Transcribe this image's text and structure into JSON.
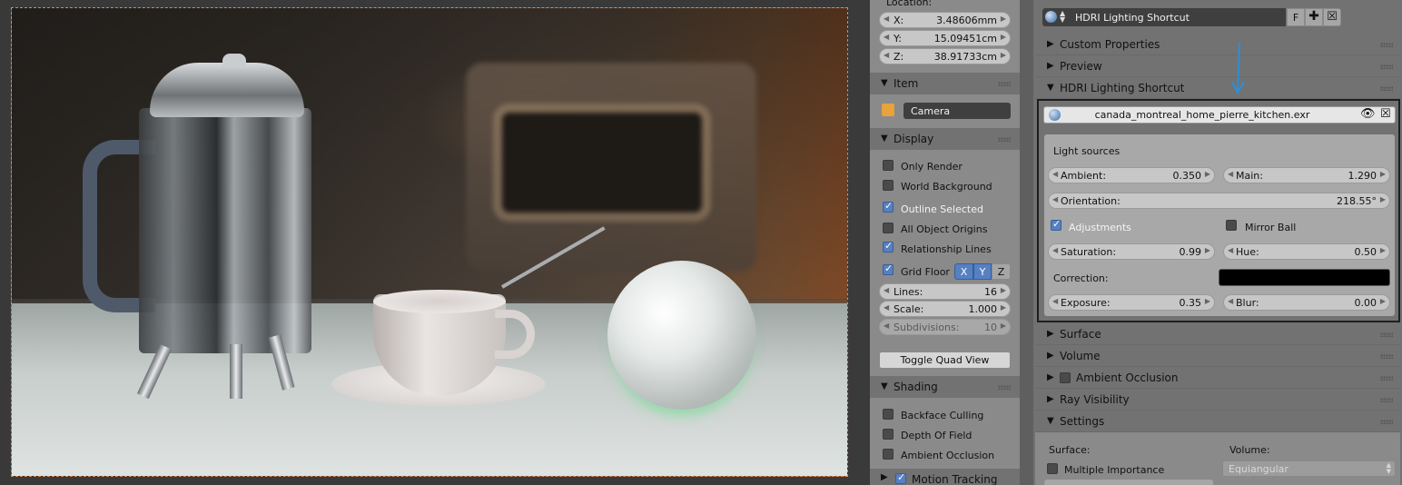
{
  "n_panel": {
    "location_label": "Location:",
    "location": {
      "x_label": "X:",
      "x": "3.48606mm",
      "y_label": "Y:",
      "y": "15.09451cm",
      "z_label": "Z:",
      "z": "38.91733cm"
    },
    "item_section": "Item",
    "item_name": "Camera",
    "display_section": "Display",
    "display_options": [
      {
        "label": "Only Render",
        "checked": false
      },
      {
        "label": "World Background",
        "checked": false
      },
      {
        "label": "Outline Selected",
        "checked": true
      },
      {
        "label": "All Object Origins",
        "checked": false
      },
      {
        "label": "Relationship Lines",
        "checked": true
      }
    ],
    "grid_floor": {
      "label": "Grid Floor",
      "checked": true,
      "x": "X",
      "y": "Y",
      "z": "Z"
    },
    "lines": {
      "label": "Lines:",
      "value": "16"
    },
    "scale": {
      "label": "Scale:",
      "value": "1.000"
    },
    "subdivisions": {
      "label": "Subdivisions:",
      "value": "10"
    },
    "toggle_quad": "Toggle Quad View",
    "shading_section": "Shading",
    "shading_options": [
      {
        "label": "Backface Culling",
        "checked": false
      },
      {
        "label": "Depth Of Field",
        "checked": false
      },
      {
        "label": "Ambient Occlusion",
        "checked": false
      }
    ],
    "motion_tracking": {
      "label": "Motion Tracking",
      "checked": true
    }
  },
  "world": {
    "name": "HDRI Lighting Shortcut",
    "fake_user": "F",
    "sections": {
      "custom_properties": "Custom Properties",
      "preview": "Preview",
      "hdri": "HDRI Lighting Shortcut",
      "surface": "Surface",
      "volume": "Volume",
      "ambient_occlusion": "Ambient Occlusion",
      "ray_visibility": "Ray Visibility",
      "settings": "Settings"
    },
    "hdri_file": "canada_montreal_home_pierre_kitchen.exr",
    "light_sources_label": "Light sources",
    "ambient": {
      "label": "Ambient:",
      "value": "0.350"
    },
    "main": {
      "label": "Main:",
      "value": "1.290"
    },
    "orientation": {
      "label": "Orientation:",
      "value": "218.55°"
    },
    "adjustments": {
      "label": "Adjustments",
      "checked": true
    },
    "mirror_ball": {
      "label": "Mirror Ball",
      "checked": false
    },
    "saturation": {
      "label": "Saturation:",
      "value": "0.99"
    },
    "hue": {
      "label": "Hue:",
      "value": "0.50"
    },
    "correction_label": "Correction:",
    "correction_color": "#000000",
    "exposure": {
      "label": "Exposure:",
      "value": "0.35"
    },
    "blur": {
      "label": "Blur:",
      "value": "0.00"
    },
    "settings": {
      "surface_label": "Surface:",
      "volume_label": "Volume:",
      "multiple_importance": {
        "label": "Multiple Importance",
        "checked": false
      },
      "volume_sampling": "Equiangular"
    }
  },
  "colors": {
    "accent": "#5680c2",
    "arrow": "#2b8fd8"
  }
}
